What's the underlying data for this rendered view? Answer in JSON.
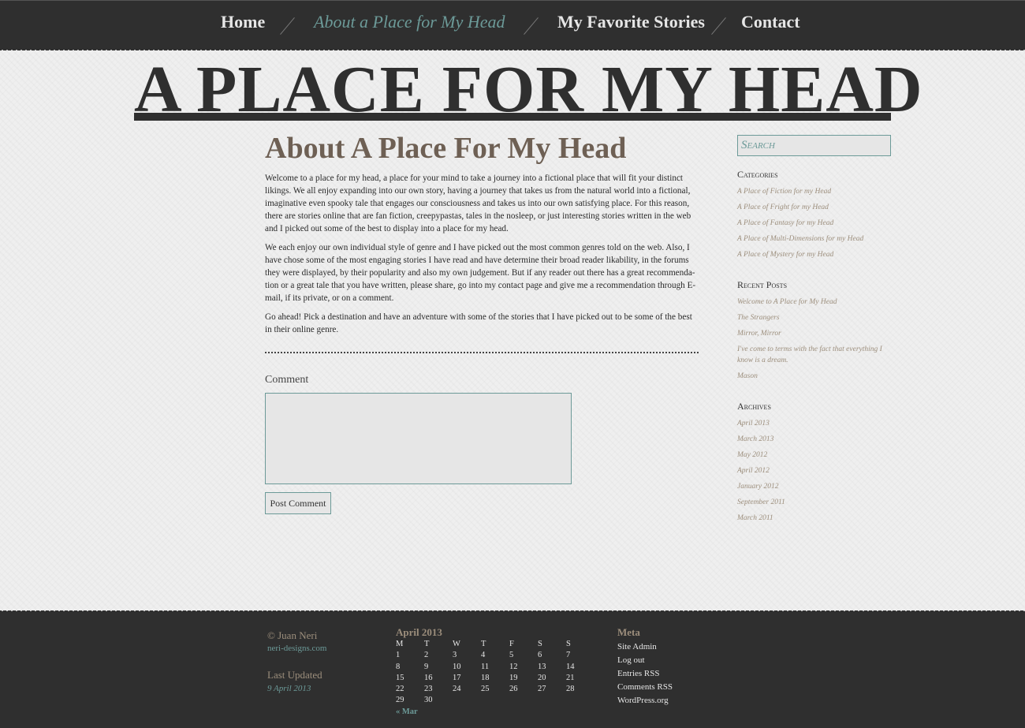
{
  "nav": {
    "items": [
      {
        "label": "Home"
      },
      {
        "label": "About a Place for My Head",
        "active": true
      },
      {
        "label": "My Favorite Stories"
      },
      {
        "label": "Contact"
      }
    ]
  },
  "site_title": "A PLACE FOR MY HEAD",
  "main": {
    "title": "About A Place For My Head",
    "paragraphs": [
      "Welcome to a place for my head, a place for your mind to take a journey into a fictional place that will fit your distinct likings. We all enjoy expanding into our own story, having a journey that takes us from the natural world into a fictional, imaginative even spooky tale that engages our consciousness and takes us into our own satisfying place. For this reason, there are stories online that are fan fiction, creepypastas, tales in the nosleep, or just interesting stories written in the web and I picked out some of the best to display into a place for my head.",
      "We each enjoy our own individual style of genre and I have picked out the most common genres told on the web. Also, I have chose some of the most engaging stories I have read and have determine their broad reader likability, in the forums they were displayed, by their popularity and also my own judgement. But if any reader out there has a great recommenda-tion or a great tale that you have written, please share, go into my contact page and give me a recommendation through E-mail, if its private, or on a comment.",
      "Go ahead! Pick a destination and have an adventure with some of the stories that I have picked out to be some of the best in their online genre."
    ],
    "comment_label": "Comment",
    "comment_value": "",
    "post_button": "Post Comment"
  },
  "sidebar": {
    "search_placeholder": "Search",
    "categories": {
      "title": "Categories",
      "items": [
        "A Place of Fiction for my Head",
        "A Place of Fright for my Head",
        "A Place of Fantasy for my Head",
        "A Place of Multi-Dimensions for my Head",
        "A Place of Mystery for my Head"
      ]
    },
    "recent_posts": {
      "title": "Recent Posts",
      "items": [
        "Welcome to A Place for My Head",
        "The Strangers",
        "Mirror, Mirror",
        "I've come to terms with the fact that everything I know is a dream.",
        "Mason"
      ]
    },
    "archives": {
      "title": "Archives",
      "items": [
        "April 2013",
        "March 2013",
        "May 2012",
        "April 2012",
        "January 2012",
        "September 2011",
        "March 2011"
      ]
    }
  },
  "footer": {
    "copyright": "© Juan Neri",
    "site": "neri-designs.com",
    "last_updated_label": "Last Updated",
    "last_updated_date": "9 April 2013",
    "calendar": {
      "title": "April 2013",
      "days": [
        "M",
        "T",
        "W",
        "T",
        "F",
        "S",
        "S"
      ],
      "cells": [
        "1",
        "2",
        "3",
        "4",
        "5",
        "6",
        "7",
        "8",
        "9",
        "10",
        "11",
        "12",
        "13",
        "14",
        "15",
        "16",
        "17",
        "18",
        "19",
        "20",
        "21",
        "22",
        "23",
        "24",
        "25",
        "26",
        "27",
        "28",
        "29",
        "30"
      ],
      "prev": "« Mar"
    },
    "meta": {
      "title": "Meta",
      "items": [
        "Site Admin",
        "Log out",
        "Entries RSS",
        "Comments RSS",
        "WordPress.org"
      ]
    }
  },
  "colors": {
    "bar": "#2f2f2f",
    "accent_teal": "#6c9a98",
    "accent_brown": "#9c8e7c",
    "title_brown": "#6e6054"
  }
}
